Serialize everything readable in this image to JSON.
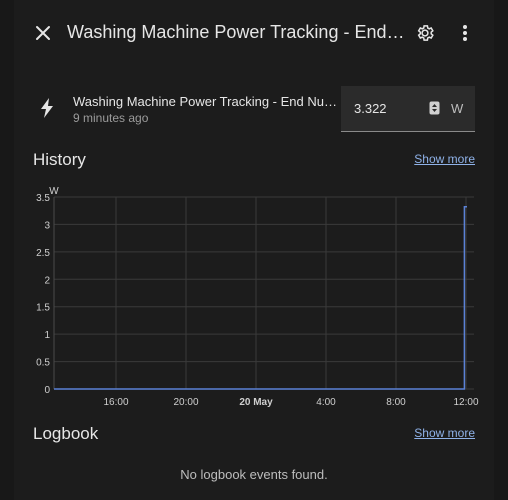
{
  "dialog": {
    "title": "Washing Machine Power Tracking - End Nu...",
    "close_icon": "close-icon",
    "settings_icon": "gear-icon",
    "menu_icon": "more-vert-icon"
  },
  "entity": {
    "icon": "flash-icon",
    "name": "Washing Machine Power Tracking - End Numbe...",
    "last_changed": "9 minutes ago",
    "value": "3.322",
    "unit": "W"
  },
  "history": {
    "title": "History",
    "show_more": "Show more"
  },
  "logbook": {
    "title": "Logbook",
    "show_more": "Show more",
    "empty_message": "No logbook events found."
  },
  "colors": {
    "background": "#1c1c1c",
    "line": "#5b82d6",
    "link": "#8fb2e8",
    "grid": "#3a3a3a"
  },
  "chart_data": {
    "type": "line",
    "ylabel": "W",
    "ylim": [
      0,
      3.5
    ],
    "y_ticks": [
      "0",
      "0.5",
      "1",
      "1.5",
      "2",
      "2.5",
      "3",
      "3.5"
    ],
    "x_ticks": [
      "16:00",
      "20:00",
      "20 May",
      "4:00",
      "8:00",
      "12:00"
    ],
    "grid": true,
    "series": [
      {
        "points": [
          {
            "t": 0,
            "y": 0
          },
          {
            "t": 1,
            "y": 0
          },
          {
            "t": 23.45,
            "y": 0
          },
          {
            "t": 23.45,
            "y": 3.322
          },
          {
            "t": 23.6,
            "y": 3.322
          }
        ]
      }
    ]
  }
}
